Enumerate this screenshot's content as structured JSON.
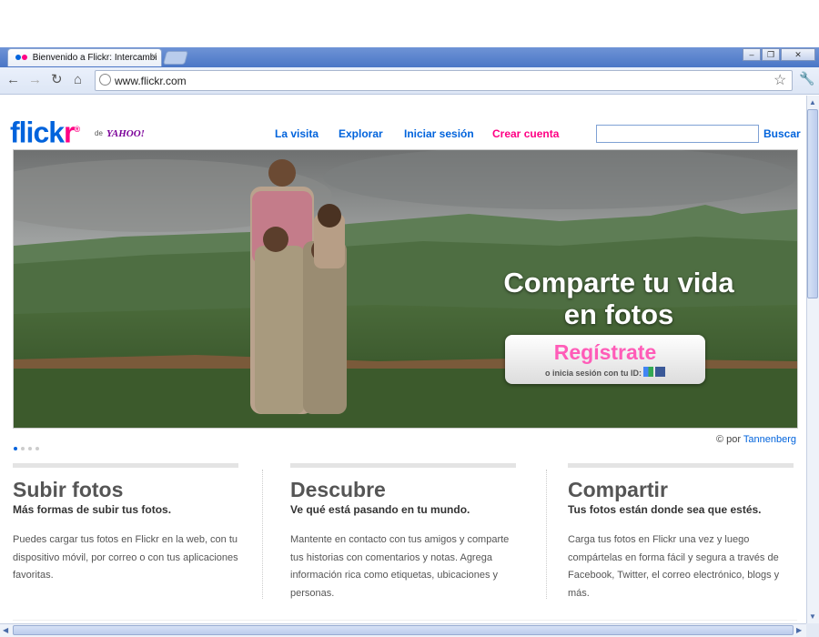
{
  "browser": {
    "tab_title": "Bienvenido a Flickr: Intercambi",
    "tab_close": "×",
    "url": "www.flickr.com",
    "window_buttons": [
      "–",
      "❐",
      "✕"
    ],
    "nav_icons": [
      "back-icon",
      "forward-icon",
      "reload-icon",
      "home-icon"
    ]
  },
  "flickr": {
    "logo_left": "flickr",
    "logo_reg": "®",
    "logo_by": "de",
    "yahoo": "YAHOO!",
    "nav": [
      "La visita",
      "Explorar",
      "Iniciar sesión",
      "Crear cuenta"
    ],
    "search_button": "Buscar",
    "search_value": "",
    "hero": {
      "tagline_line1": "Comparte tu vida",
      "tagline_line2": "en fotos",
      "signup_label": "Regístrate",
      "signup_sub": "o inicia sesión con tu ID:",
      "credit_prefix": "© por",
      "credit_name": "Tannenberg"
    },
    "columns": [
      {
        "title": "Subir fotos",
        "subtitle": "Más formas de subir tus fotos.",
        "body": "Puedes cargar tus fotos en Flickr en la web, con tu dispositivo móvil, por correo o con tus aplicaciones favoritas."
      },
      {
        "title": "Descubre",
        "subtitle": "Ve qué está pasando en tu mundo.",
        "body": "Mantente en contacto con tus amigos y comparte tus historias con comentarios y notas. Agrega información rica como etiquetas, ubicaciones y personas."
      },
      {
        "title": "Compartir",
        "subtitle": "Tus fotos están donde sea que estés.",
        "body": "Carga tus fotos en Flickr una vez y luego compártelas en forma fácil y segura a través de Facebook, Twitter, el correo electrónico, blogs y más."
      }
    ]
  },
  "colors": {
    "flickr_blue": "#0063dc",
    "flickr_pink": "#ff0084",
    "chrome_frame": "#4a76c6"
  }
}
